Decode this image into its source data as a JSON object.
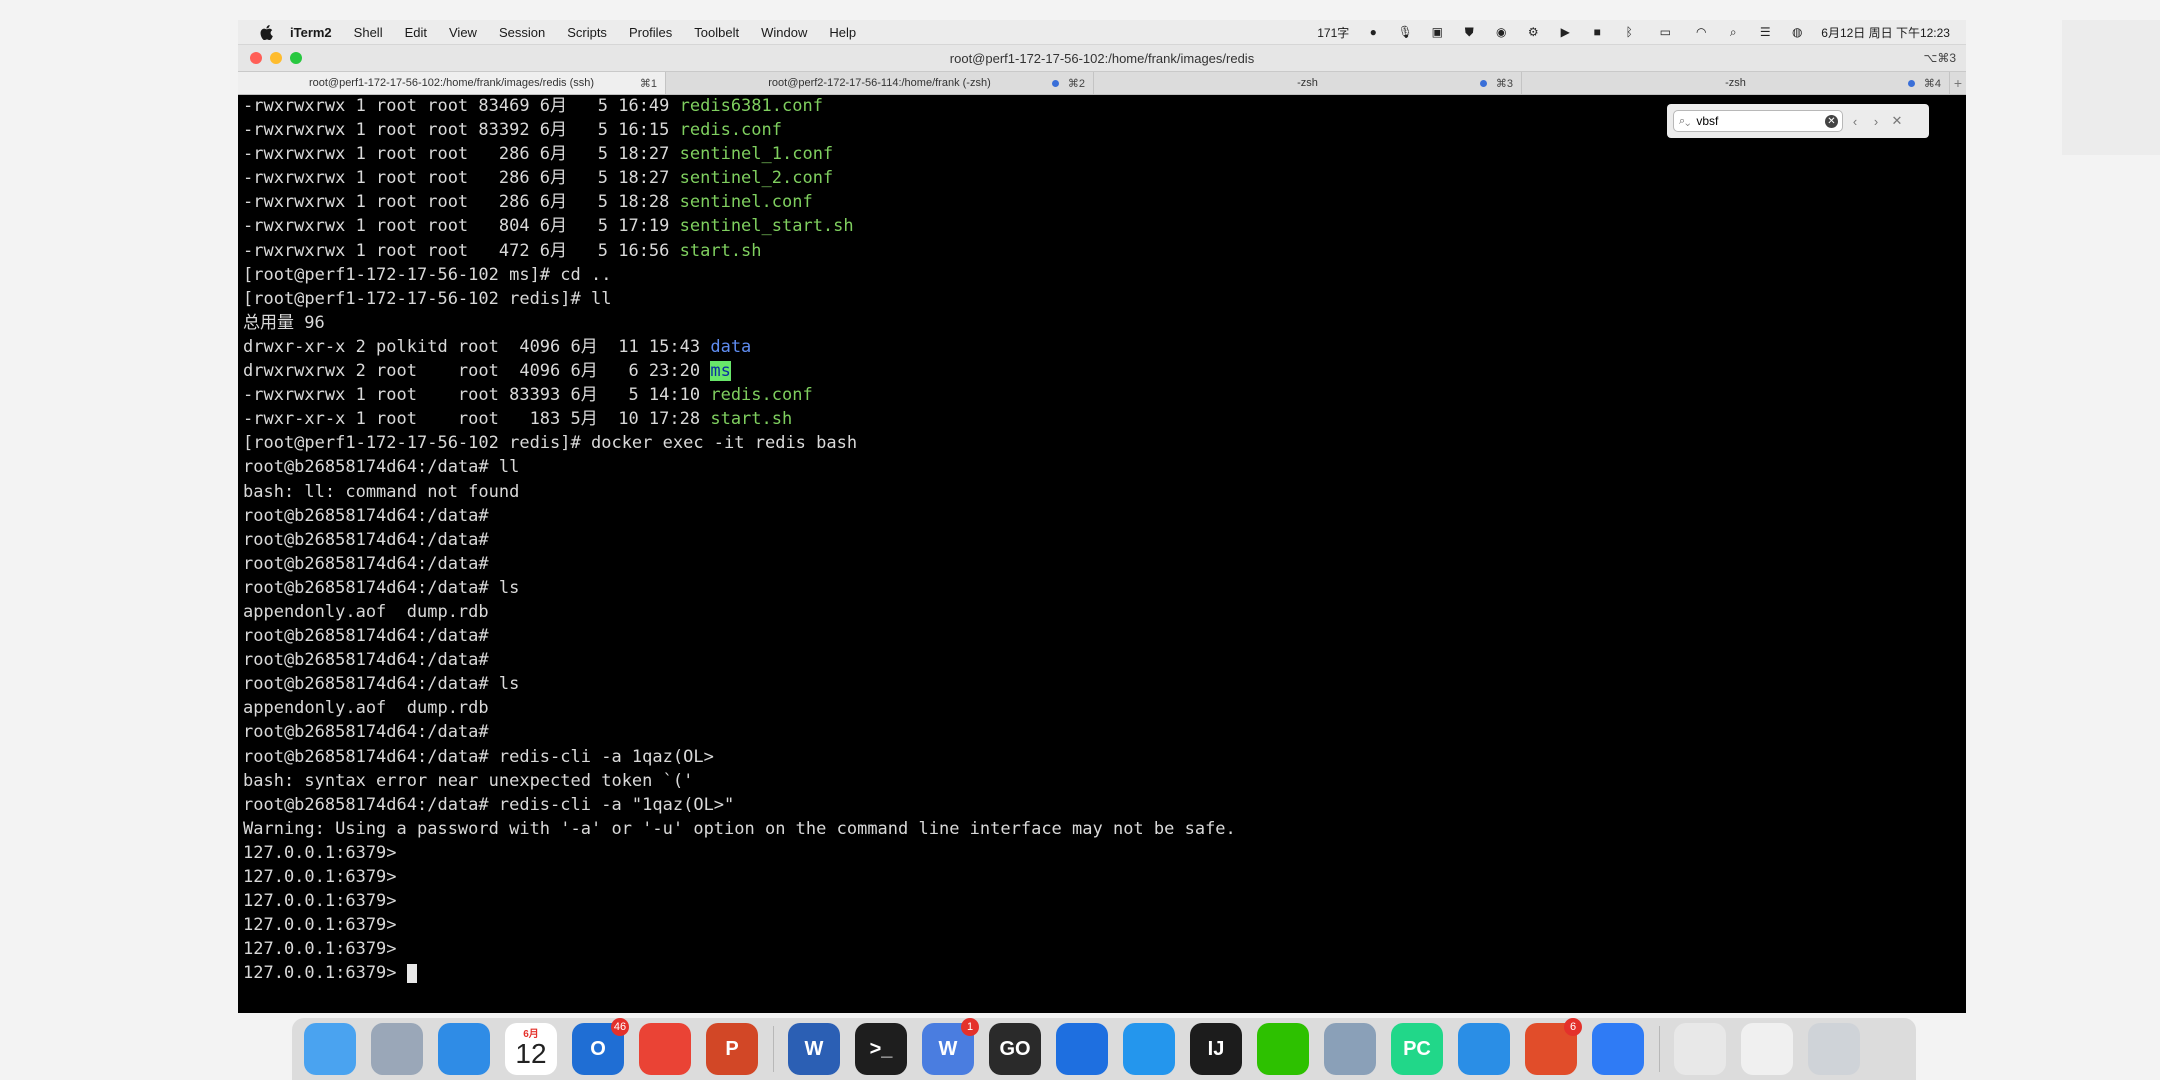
{
  "menubar": {
    "app_name": "iTerm2",
    "items": [
      "Shell",
      "Edit",
      "View",
      "Session",
      "Scripts",
      "Profiles",
      "Toolbelt",
      "Window",
      "Help"
    ],
    "word_count": "171字",
    "datetime": "6月12日 周日 下午12:23"
  },
  "window": {
    "title": "root@perf1-172-17-56-102:/home/frank/images/redis",
    "shortcut": "⌥⌘3",
    "tabs": [
      {
        "label": "root@perf1-172-17-56-102:/home/frank/images/redis (ssh)",
        "shortcut": "⌘1",
        "active": true
      },
      {
        "label": "root@perf2-172-17-56-114:/home/frank (-zsh)",
        "shortcut": "⌘2",
        "active": false
      },
      {
        "label": "-zsh",
        "shortcut": "⌘3",
        "active": false
      },
      {
        "label": "-zsh",
        "shortcut": "⌘4",
        "active": false
      }
    ]
  },
  "find": {
    "query": "vbsf"
  },
  "terminal": {
    "lines": [
      {
        "text": "-rwxrwxrwx 1 root root 83469 6月   5 16:49 ",
        "file": "redis6381.conf",
        "file_style": "green"
      },
      {
        "text": "-rwxrwxrwx 1 root root 83392 6月   5 16:15 ",
        "file": "redis.conf",
        "file_style": "green"
      },
      {
        "text": "-rwxrwxrwx 1 root root   286 6月   5 18:27 ",
        "file": "sentinel_1.conf",
        "file_style": "green"
      },
      {
        "text": "-rwxrwxrwx 1 root root   286 6月   5 18:27 ",
        "file": "sentinel_2.conf",
        "file_style": "green"
      },
      {
        "text": "-rwxrwxrwx 1 root root   286 6月   5 18:28 ",
        "file": "sentinel.conf",
        "file_style": "green"
      },
      {
        "text": "-rwxrwxrwx 1 root root   804 6月   5 17:19 ",
        "file": "sentinel_start.sh",
        "file_style": "green"
      },
      {
        "text": "-rwxrwxrwx 1 root root   472 6月   5 16:56 ",
        "file": "start.sh",
        "file_style": "green"
      },
      {
        "text": "[root@perf1-172-17-56-102 ms]# cd .."
      },
      {
        "text": "[root@perf1-172-17-56-102 redis]# ll"
      },
      {
        "text": "总用量 96"
      },
      {
        "text": "drwxr-xr-x 2 polkitd root  4096 6月  11 15:43 ",
        "file": "data",
        "file_style": "blue"
      },
      {
        "text": "drwxrwxrwx 2 root    root  4096 6月   6 23:20 ",
        "file": "ms",
        "file_style": "highlight"
      },
      {
        "text": "-rwxrwxrwx 1 root    root 83393 6月   5 14:10 ",
        "file": "redis.conf",
        "file_style": "green"
      },
      {
        "text": "-rwxr-xr-x 1 root    root   183 5月  10 17:28 ",
        "file": "start.sh",
        "file_style": "green"
      },
      {
        "text": "[root@perf1-172-17-56-102 redis]# docker exec -it redis bash"
      },
      {
        "text": "root@b26858174d64:/data# ll"
      },
      {
        "text": "bash: ll: command not found"
      },
      {
        "text": "root@b26858174d64:/data#"
      },
      {
        "text": "root@b26858174d64:/data#"
      },
      {
        "text": "root@b26858174d64:/data#"
      },
      {
        "text": "root@b26858174d64:/data# ls"
      },
      {
        "text": "appendonly.aof  dump.rdb"
      },
      {
        "text": "root@b26858174d64:/data#"
      },
      {
        "text": "root@b26858174d64:/data#"
      },
      {
        "text": "root@b26858174d64:/data# ls"
      },
      {
        "text": "appendonly.aof  dump.rdb"
      },
      {
        "text": "root@b26858174d64:/data#"
      },
      {
        "text": "root@b26858174d64:/data# redis-cli -a 1qaz(OL>"
      },
      {
        "text": "bash: syntax error near unexpected token `('"
      },
      {
        "text": "root@b26858174d64:/data# redis-cli -a \"1qaz(OL>\""
      },
      {
        "text": "Warning: Using a password with '-a' or '-u' option on the command line interface may not be safe."
      },
      {
        "text": "127.0.0.1:6379>"
      },
      {
        "text": "127.0.0.1:6379>"
      },
      {
        "text": "127.0.0.1:6379>"
      },
      {
        "text": "127.0.0.1:6379>"
      },
      {
        "text": "127.0.0.1:6379>"
      },
      {
        "text": "127.0.0.1:6379> ",
        "cursor": true
      }
    ]
  },
  "dock": {
    "items": [
      {
        "name": "finder-icon",
        "label": "",
        "color": "#4aa3f0"
      },
      {
        "name": "launchpad-icon",
        "label": "",
        "color": "#9aa7b8"
      },
      {
        "name": "safari-icon",
        "label": "",
        "color": "#2f8ce6"
      },
      {
        "name": "calendar-icon",
        "label": "12",
        "month": "6月",
        "color": "#ffffff"
      },
      {
        "name": "outlook-icon",
        "label": "O",
        "color": "#1f6ed4",
        "badge": "46"
      },
      {
        "name": "chrome-icon",
        "label": "",
        "color": "#ea4335"
      },
      {
        "name": "powerpoint-icon",
        "label": "P",
        "color": "#d24726"
      },
      {
        "sep": true
      },
      {
        "name": "word-icon",
        "label": "W",
        "color": "#2b5fb4"
      },
      {
        "name": "terminal-icon",
        "label": ">_",
        "color": "#1e1e1e"
      },
      {
        "name": "wps-icon",
        "label": "W",
        "color": "#4a7de0",
        "badge": "1"
      },
      {
        "name": "goland-icon",
        "label": "GO",
        "color": "#2a2a2a"
      },
      {
        "name": "maps-icon",
        "label": "",
        "color": "#1e6fe0"
      },
      {
        "name": "docker-icon",
        "label": "",
        "color": "#2496ed"
      },
      {
        "name": "intellij-icon",
        "label": "IJ",
        "color": "#1c1c1c"
      },
      {
        "name": "wechat-icon",
        "label": "",
        "color": "#2dc100"
      },
      {
        "name": "preview-icon",
        "label": "",
        "color": "#8aa0b8"
      },
      {
        "name": "pycharm-icon",
        "label": "PC",
        "color": "#21d789"
      },
      {
        "name": "vscode-icon",
        "label": "",
        "color": "#2a8ee6"
      },
      {
        "name": "office-icon",
        "label": "",
        "color": "#e14d2a",
        "badge": "6"
      },
      {
        "name": "feishu-icon",
        "label": "",
        "color": "#2f7bf5"
      },
      {
        "sep": true
      },
      {
        "name": "document-icon",
        "label": "",
        "color": "#e8e8e8"
      },
      {
        "name": "downloads-icon",
        "label": "",
        "color": "#f0f0f0"
      },
      {
        "name": "trash-icon",
        "label": "",
        "color": "#cfd3d8"
      }
    ]
  }
}
